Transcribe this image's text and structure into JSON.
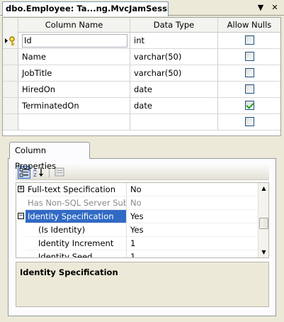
{
  "document_tab": {
    "title": "dbo.Employee: Ta...ng.MvcJamSession)",
    "pin_icon": "pin-down-icon",
    "close_icon": "close-icon"
  },
  "grid": {
    "headers": [
      "Column Name",
      "Data Type",
      "Allow Nulls"
    ],
    "rows": [
      {
        "name": "Id",
        "type": "int",
        "allow_nulls": false,
        "primary_key": true,
        "current": true
      },
      {
        "name": "Name",
        "type": "varchar(50)",
        "allow_nulls": false
      },
      {
        "name": "JobTitle",
        "type": "varchar(50)",
        "allow_nulls": false
      },
      {
        "name": "HiredOn",
        "type": "date",
        "allow_nulls": false
      },
      {
        "name": "TerminatedOn",
        "type": "date",
        "allow_nulls": true
      },
      {
        "name": "",
        "type": "",
        "allow_nulls": false
      }
    ]
  },
  "properties": {
    "tab_label": "Column Properties",
    "toolbar": [
      "categorized-icon",
      "alphabetical-sort-icon",
      "property-pages-icon"
    ],
    "rows": [
      {
        "name": "Full-text Specification",
        "value": "No",
        "expander": "+",
        "grayed": false
      },
      {
        "name": "Has Non-SQL Server Subs",
        "value": "No",
        "expander": "",
        "grayed": true
      },
      {
        "name": "Identity Specification",
        "value": "Yes",
        "expander": "−",
        "grayed": false,
        "selected": true
      },
      {
        "name": "(Is Identity)",
        "value": "Yes",
        "expander": "",
        "grayed": false,
        "indent": true
      },
      {
        "name": "Identity Increment",
        "value": "1",
        "expander": "",
        "grayed": false,
        "indent": true
      },
      {
        "name": "Identity Seed",
        "value": "1",
        "expander": "",
        "grayed": false,
        "indent": true
      }
    ],
    "description_title": "Identity Specification"
  },
  "colors": {
    "selection": "#316ac5",
    "checkbox_border": "#1c5180",
    "checkmark": "#21a121",
    "panel_background": "#ece9d8"
  }
}
